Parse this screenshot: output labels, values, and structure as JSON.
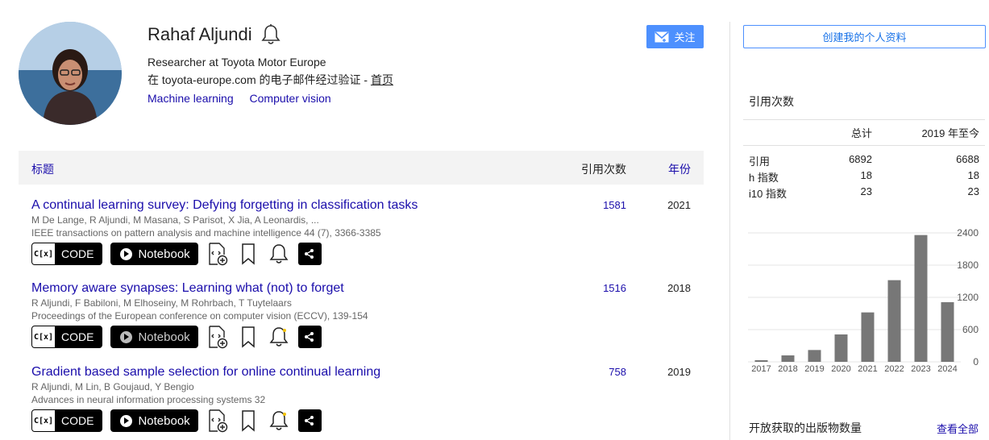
{
  "profile": {
    "name": "Rahaf Aljundi",
    "affiliation": "Researcher at Toyota Motor Europe",
    "verified_email": "在 toyota-europe.com 的电子邮件经过验证 - ",
    "homepage_label": "首页",
    "interests": [
      "Machine learning",
      "Computer vision"
    ],
    "follow_label": "关注"
  },
  "table": {
    "header_title": "标题",
    "header_cited": "引用次数",
    "header_year": "年份",
    "code_label": "CODE",
    "notebook_label": "Notebook",
    "rows": [
      {
        "title": "A continual learning survey: Defying forgetting in classification tasks",
        "authors": "M De Lange, R Aljundi, M Masana, S Parisot, X Jia, A Leonardis, ...",
        "venue": "IEEE transactions on pattern analysis and machine intelligence 44 (7), 3366-3385",
        "cited": "1581",
        "year": "2021"
      },
      {
        "title": "Memory aware synapses: Learning what (not) to forget",
        "authors": "R Aljundi, F Babiloni, M Elhoseiny, M Rohrbach, T Tuytelaars",
        "venue": "Proceedings of the European conference on computer vision (ECCV), 139-154",
        "cited": "1516",
        "year": "2018"
      },
      {
        "title": "Gradient based sample selection for online continual learning",
        "authors": "R Aljundi, M Lin, B Goujaud, Y Bengio",
        "venue": "Advances in neural information processing systems 32",
        "cited": "758",
        "year": "2019"
      }
    ]
  },
  "sidebar": {
    "create_profile_label": "创建我的个人资料",
    "cited_by_title": "引用次数",
    "col_total": "总计",
    "col_since": "2019 年至今",
    "metrics": [
      {
        "label": "引用",
        "total": "6892",
        "since": "6688"
      },
      {
        "label": "h 指数",
        "total": "18",
        "since": "18"
      },
      {
        "label": "i10 指数",
        "total": "23",
        "since": "23"
      }
    ],
    "open_access_title": "开放获取的出版物数量",
    "view_all_label": "查看全部"
  },
  "chart_data": {
    "type": "bar",
    "categories": [
      "2017",
      "2018",
      "2019",
      "2020",
      "2021",
      "2022",
      "2023",
      "2024"
    ],
    "values": [
      30,
      120,
      220,
      510,
      920,
      1520,
      2360,
      1110
    ],
    "ylim": [
      0,
      2400
    ],
    "yticks": [
      0,
      600,
      1200,
      1800,
      2400
    ],
    "bar_color": "#777777",
    "grid": true
  },
  "colors": {
    "link": "#1a0dab",
    "accent": "#4d90fe"
  }
}
